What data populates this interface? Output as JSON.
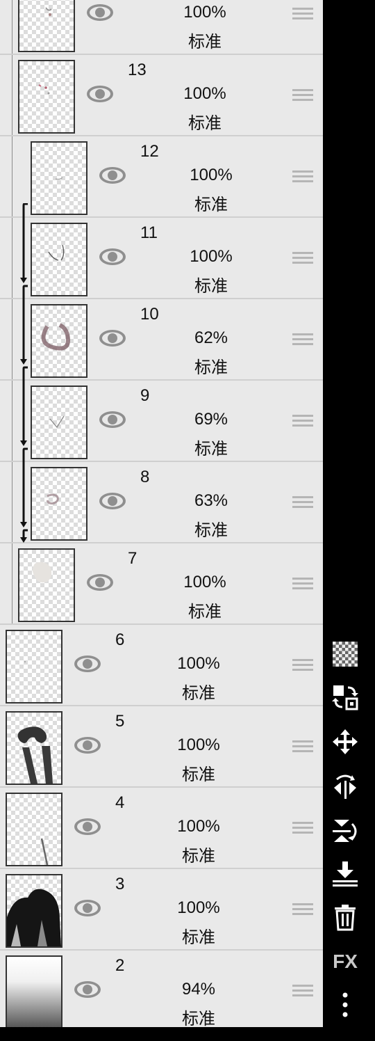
{
  "layers": [
    {
      "number": "",
      "opacity": "100%",
      "blend": "标准"
    },
    {
      "number": "13",
      "opacity": "100%",
      "blend": "标准"
    },
    {
      "number": "12",
      "opacity": "100%",
      "blend": "标准"
    },
    {
      "number": "11",
      "opacity": "100%",
      "blend": "标准"
    },
    {
      "number": "10",
      "opacity": "62%",
      "blend": "标准"
    },
    {
      "number": "9",
      "opacity": "69%",
      "blend": "标准"
    },
    {
      "number": "8",
      "opacity": "63%",
      "blend": "标准"
    },
    {
      "number": "7",
      "opacity": "100%",
      "blend": "标准"
    },
    {
      "number": "6",
      "opacity": "100%",
      "blend": "标准"
    },
    {
      "number": "5",
      "opacity": "100%",
      "blend": "标准"
    },
    {
      "number": "4",
      "opacity": "100%",
      "blend": "标准"
    },
    {
      "number": "3",
      "opacity": "100%",
      "blend": "标准"
    },
    {
      "number": "2",
      "opacity": "94%",
      "blend": "标准"
    }
  ],
  "toolbar": {
    "fx_label": "FX",
    "icons": [
      "transparency-checker-icon",
      "swap-layer-icon",
      "move-icon",
      "flip-horizontal-icon",
      "flip-vertical-icon",
      "merge-down-icon",
      "delete-icon",
      "fx-icon",
      "more-icon"
    ]
  }
}
